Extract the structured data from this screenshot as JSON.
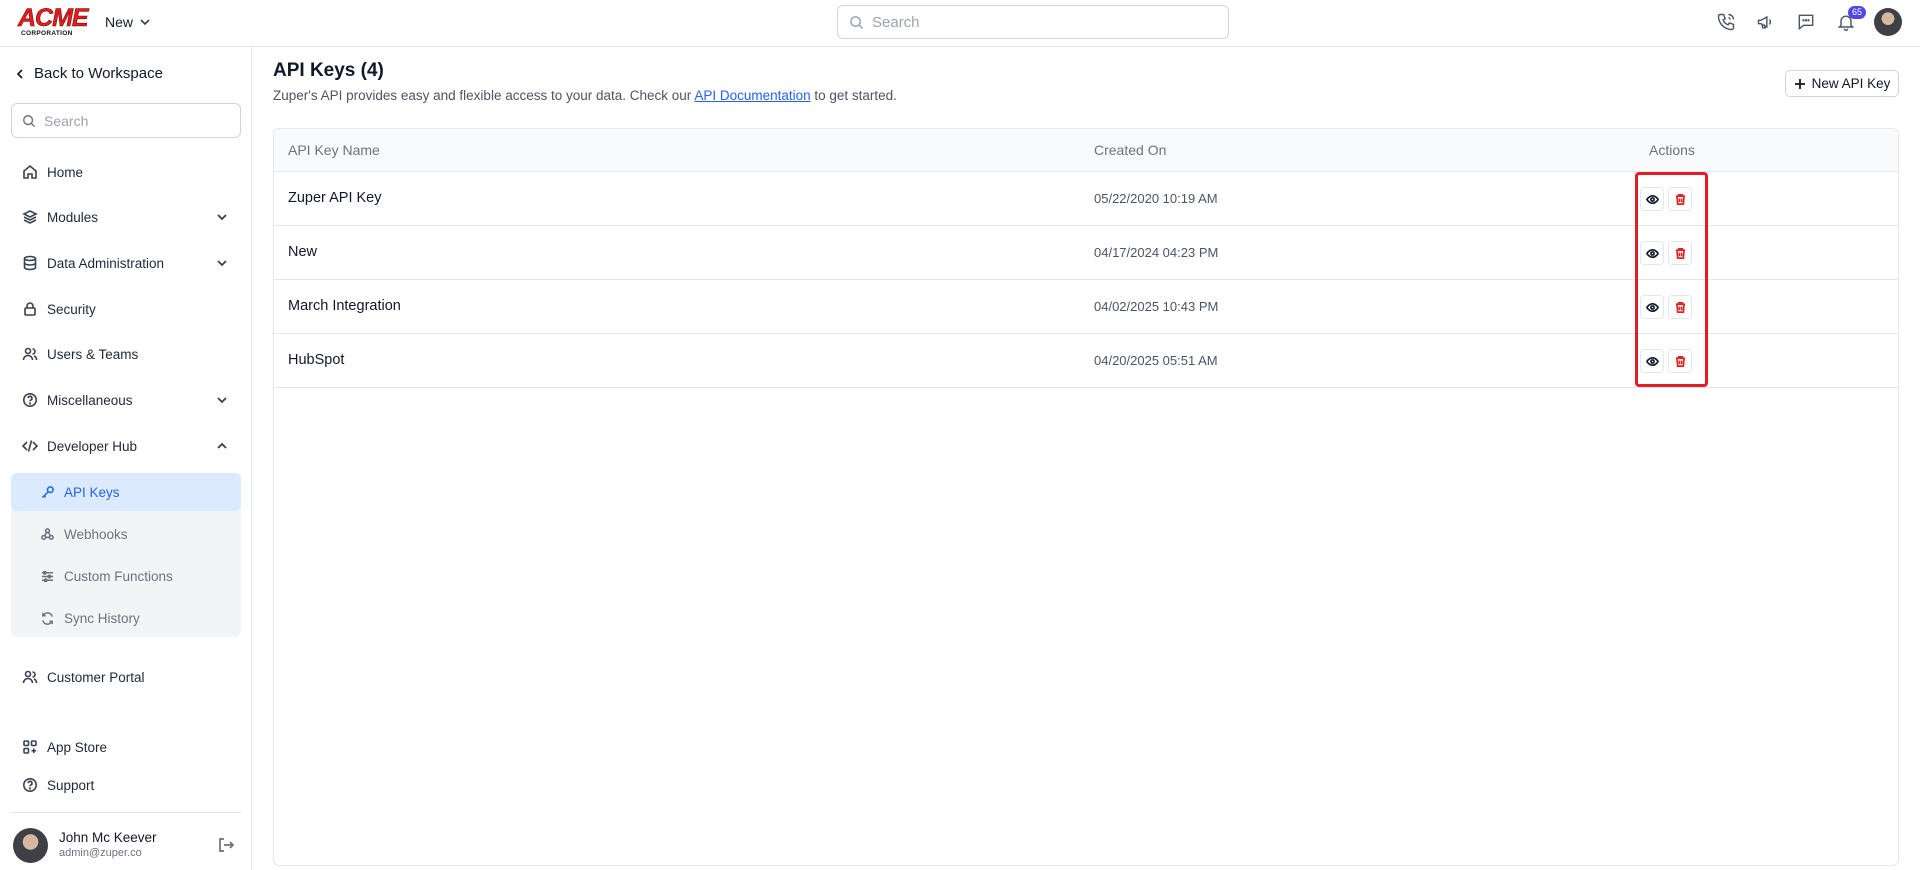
{
  "topbar": {
    "logo_text": "ACME",
    "logo_subtext": "CORPORATION",
    "workspace_label": "New",
    "search_placeholder": "Search",
    "notification_count": "65",
    "icons": [
      "phone-icon",
      "megaphone-icon",
      "chat-icon",
      "bell-icon"
    ]
  },
  "sidebar": {
    "back_label": "Back to Workspace",
    "search_placeholder": "Search",
    "items": [
      {
        "label": "Home",
        "icon": "home-icon"
      },
      {
        "label": "Modules",
        "icon": "layers-icon"
      },
      {
        "label": "Data Administration",
        "icon": "database-icon"
      },
      {
        "label": "Security",
        "icon": "lock-icon"
      },
      {
        "label": "Users & Teams",
        "icon": "users-icon"
      },
      {
        "label": "Miscellaneous",
        "icon": "help-circle-icon"
      },
      {
        "label": "Developer Hub",
        "icon": "code-icon"
      }
    ],
    "dev_hub_items": [
      {
        "label": "API Keys",
        "icon": "key-icon",
        "active": true
      },
      {
        "label": "Webhooks",
        "icon": "webhook-icon"
      },
      {
        "label": "Custom Functions",
        "icon": "sliders-icon"
      },
      {
        "label": "Sync History",
        "icon": "refresh-icon"
      }
    ],
    "portal_label": "Customer Portal",
    "app_store_label": "App Store",
    "support_label": "Support",
    "user": {
      "name": "John Mc Keever",
      "email": "admin@zuper.co"
    }
  },
  "main": {
    "title": "API Keys (4)",
    "description_before": "Zuper's API provides easy and flexible access to your data. Check our ",
    "description_link": "API Documentation",
    "description_after": " to get started.",
    "new_button_label": "New API Key",
    "table": {
      "headers": {
        "name": "API Key Name",
        "created": "Created On",
        "actions": "Actions"
      },
      "rows": [
        {
          "name": "Zuper API Key",
          "created": "05/22/2020 10:19 AM"
        },
        {
          "name": "New",
          "created": "04/17/2024 04:23 PM"
        },
        {
          "name": "March Integration",
          "created": "04/02/2025 10:43 PM"
        },
        {
          "name": "HubSpot",
          "created": "04/20/2025 05:51 AM"
        }
      ]
    }
  },
  "colors": {
    "accent": "#2563eb",
    "active_bg": "#dbeafe",
    "delete": "#dc2626",
    "highlight_border": "#e11d2a",
    "badge": "#4f46e5"
  }
}
